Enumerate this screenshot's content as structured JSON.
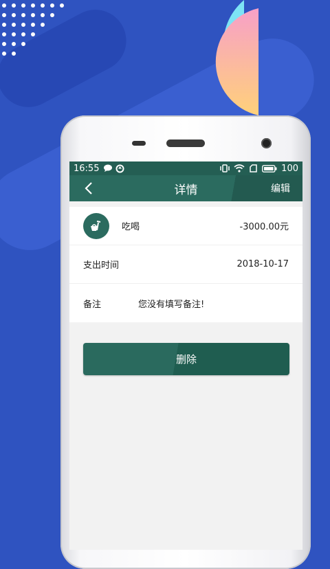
{
  "colors": {
    "background": "#2f53c0",
    "header": "#2b6b5f",
    "accent_pink": "#f5a3c2",
    "accent_cyan": "#7de3f5"
  },
  "statusbar": {
    "time": "16:55",
    "battery": "100"
  },
  "header": {
    "title": "详情",
    "edit_label": "编辑"
  },
  "record": {
    "category_label": "吃喝",
    "amount": "-3000.00元",
    "time_label": "支出时间",
    "time_value": "2018-10-17",
    "note_label": "备注",
    "note_value": "您没有填写备注!"
  },
  "actions": {
    "delete_label": "删除"
  }
}
